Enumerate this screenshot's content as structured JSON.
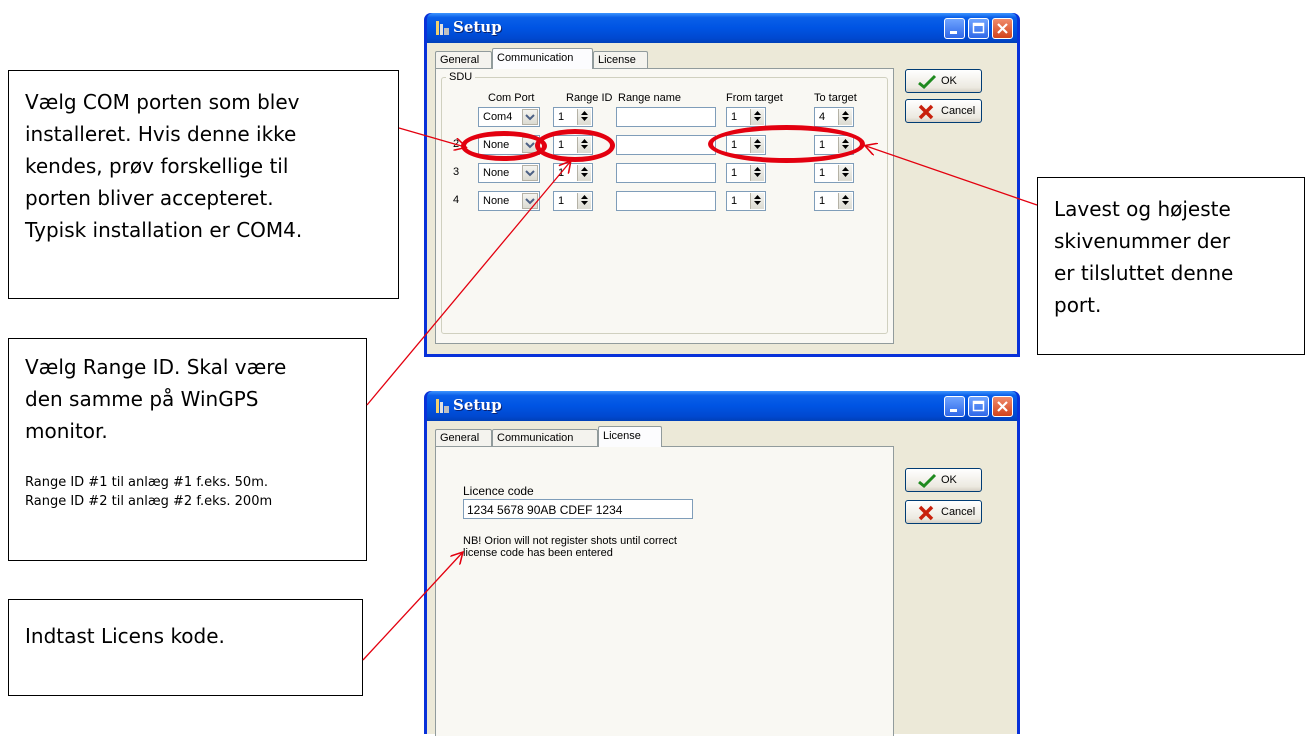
{
  "callouts": {
    "com_port": [
      "Vælg COM porten som blev",
      "installeret. Hvis denne ikke",
      "kendes, prøv forskellige til",
      "porten bliver accepteret.",
      "Typisk installation er COM4."
    ],
    "range_id": {
      "lines": [
        "Vælg Range ID. Skal være",
        "den samme på WinGPS",
        "monitor."
      ],
      "notes": [
        "Range ID #1 til anlæg #1 f.eks. 50m.",
        "Range ID #2 til anlæg #2 f.eks. 200m"
      ]
    },
    "license": "Indtast Licens kode.",
    "target": [
      "Lavest og højeste",
      "skivenummer der",
      "er tilsluttet denne",
      "port."
    ]
  },
  "window1": {
    "title": "Setup",
    "tabs": [
      "General",
      "Communication",
      "License"
    ],
    "group_label": "SDU",
    "headers": [
      "Com Port",
      "Range ID",
      "Range name",
      "From target",
      "To target"
    ],
    "rows": [
      {
        "num": "",
        "com": "Com4",
        "range_id": "1",
        "name": "",
        "from": "1",
        "to": "4"
      },
      {
        "num": "2",
        "com": "None",
        "range_id": "1",
        "name": "",
        "from": "1",
        "to": "1"
      },
      {
        "num": "3",
        "com": "None",
        "range_id": "1",
        "name": "",
        "from": "1",
        "to": "1"
      },
      {
        "num": "4",
        "com": "None",
        "range_id": "1",
        "name": "",
        "from": "1",
        "to": "1"
      }
    ],
    "ok_label": "OK",
    "cancel_label": "Cancel"
  },
  "window2": {
    "title": "Setup",
    "tabs": [
      "General",
      "Communication",
      "License"
    ],
    "licence_label": "Licence code",
    "licence_value": "1234 5678 90AB CDEF 1234",
    "note_lines": [
      "NB! Orion will not register shots until correct",
      "license code has been entered"
    ],
    "ok_label": "OK",
    "cancel_label": "Cancel"
  },
  "colors": {
    "annotation_red": "#e3000f",
    "xp_blue": "#0054e3",
    "dialog_bg": "#ece9d8"
  }
}
